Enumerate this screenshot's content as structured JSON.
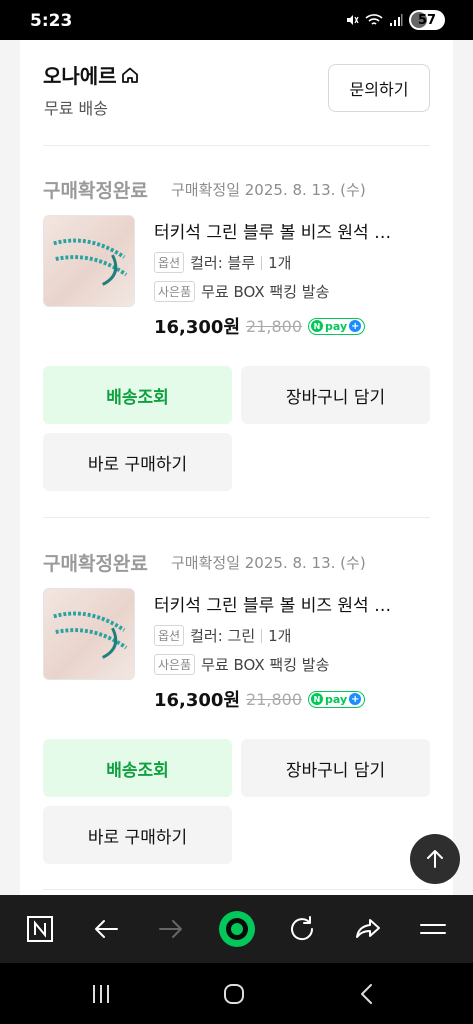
{
  "status_bar": {
    "time": "5:23",
    "battery": "57",
    "icons": [
      "mute-icon",
      "wifi-icon",
      "signal-icon",
      "battery-icon"
    ]
  },
  "store": {
    "name": "오나에르",
    "shipping": "무료 배송",
    "inquiry_label": "문의하기"
  },
  "orders": [
    {
      "status": "구매확정완료",
      "date": "구매확정일 2025. 8. 13. (수)",
      "product_name": "터키석 그린 블루 볼 비즈 원석 …",
      "option_tag": "옵션",
      "option_value": "컬러: 블루",
      "quantity": "1개",
      "gift_tag": "사은품",
      "gift_value": "무료 BOX 팩킹 발송",
      "price": "16,300원",
      "original_price": "21,800",
      "npay_label": "pay",
      "track_label": "배송조회",
      "cart_label": "장바구니 담기",
      "buy_label": "바로 구매하기"
    },
    {
      "status": "구매확정완료",
      "date": "구매확정일 2025. 8. 13. (수)",
      "product_name": "터키석 그린 블루 볼 비즈 원석 …",
      "option_tag": "옵션",
      "option_value": "컬러: 그린",
      "quantity": "1개",
      "gift_tag": "사은품",
      "gift_value": "무료 BOX 팩킹 발송",
      "price": "16,300원",
      "original_price": "21,800",
      "npay_label": "pay",
      "track_label": "배송조회",
      "cart_label": "장바구니 담기",
      "buy_label": "바로 구매하기"
    }
  ],
  "colors": {
    "accent_green": "#03c75a",
    "track_bg": "#e5fbea",
    "track_text": "#10a040"
  },
  "toolbar": [
    "naver-home-icon",
    "back-icon",
    "forward-icon",
    "green-dot-icon",
    "refresh-icon",
    "share-icon",
    "menu-icon"
  ],
  "navbar": [
    "recents-icon",
    "home-icon",
    "back-icon"
  ]
}
